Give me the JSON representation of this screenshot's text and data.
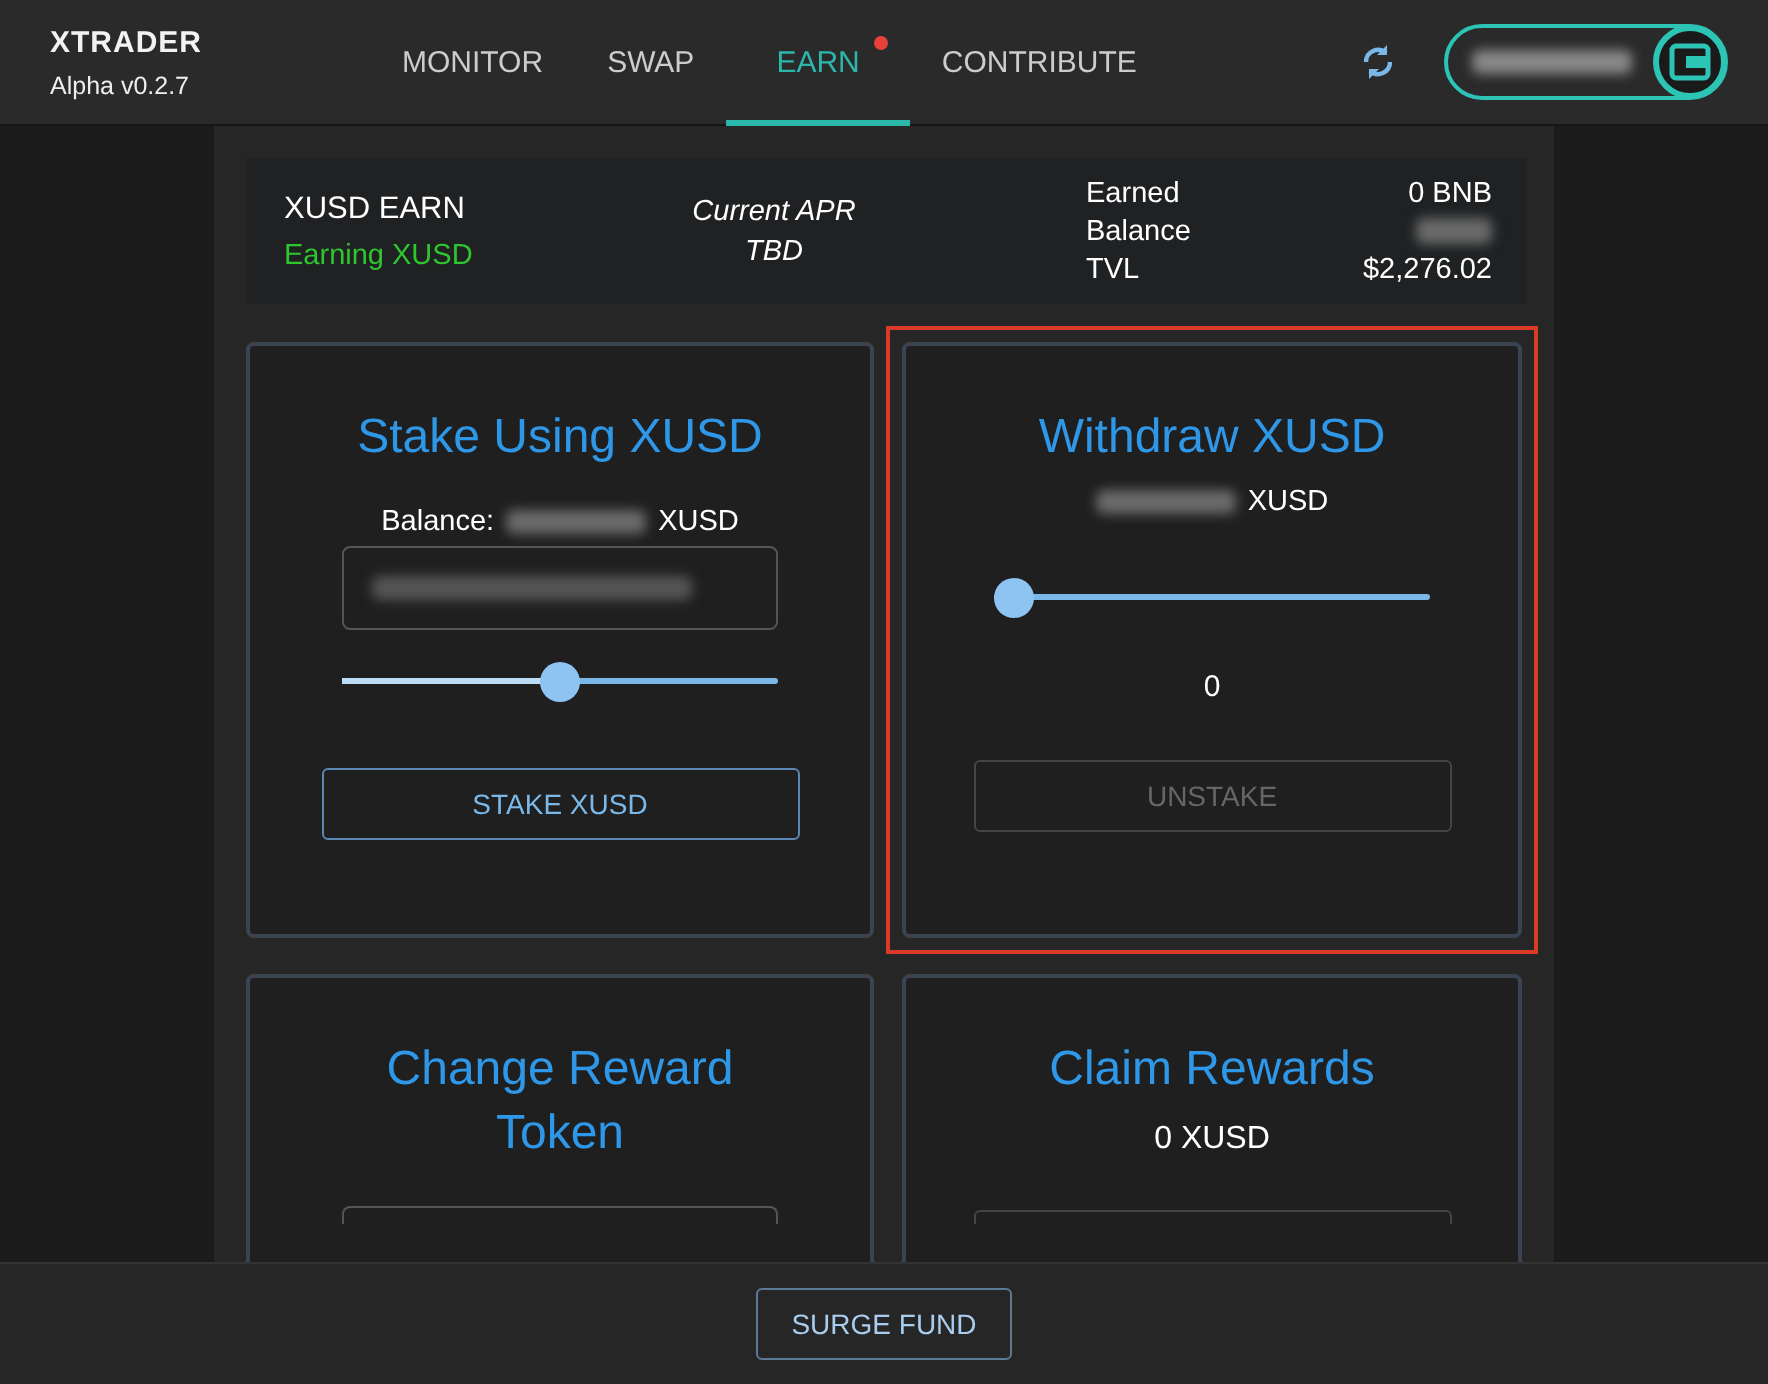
{
  "app": {
    "logo": "XTRADER",
    "version": "Alpha v0.2.7"
  },
  "tabs": [
    {
      "label": "MONITOR",
      "selected": false,
      "notification": false
    },
    {
      "label": "SWAP",
      "selected": false,
      "notification": false
    },
    {
      "label": "EARN",
      "selected": true,
      "notification": true
    },
    {
      "label": "CONTRIBUTE",
      "selected": false,
      "notification": false
    }
  ],
  "summary": {
    "title": "XUSD EARN",
    "status": "Earning XUSD",
    "apr_label": "Current APR",
    "apr_value": "TBD",
    "stats": [
      {
        "label": "Earned",
        "value": "0 BNB",
        "blurred": false
      },
      {
        "label": "Balance",
        "blurred": true
      },
      {
        "label": "TVL",
        "value": "$2,276.02",
        "blurred": false
      }
    ]
  },
  "cards": [
    {
      "kind": "stake",
      "title": "Stake Using XUSD",
      "highlighted": false,
      "balance_label": "Balance:",
      "unit": "XUSD",
      "level": 0.5,
      "button": "STAKE XUSD",
      "disabled": false
    },
    {
      "kind": "withdraw",
      "title": "Withdraw XUSD",
      "highlighted": true,
      "unit": "XUSD",
      "level": 0,
      "reading": "0",
      "button": "UNSTAKE",
      "disabled": true
    },
    {
      "kind": "token",
      "title": "Change Reward Token",
      "highlighted": false
    },
    {
      "kind": "claim",
      "title": "Claim Rewards",
      "highlighted": false,
      "amount": "0 XUSD"
    }
  ],
  "footer": {
    "button": "SURGE FUND"
  }
}
